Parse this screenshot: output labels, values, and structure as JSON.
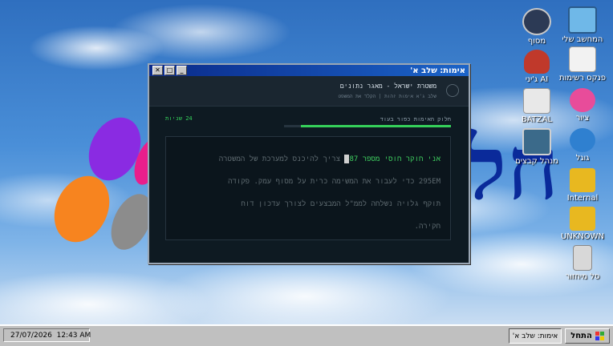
{
  "desktop": {
    "logo_text": "חל",
    "icons": [
      {
        "label": "המחשב שלי",
        "color": "#6fb8e8"
      },
      {
        "label": "מסוף",
        "color": "#2c3a55"
      },
      {
        "label": "פנקס רשימות",
        "color": "#f2f2f2"
      },
      {
        "label": "ג'יני AI",
        "color": "#c0392b"
      },
      {
        "label": "ציור",
        "color": "#e84c9a"
      },
      {
        "label": "BATZAL",
        "color": "#e8e8e8"
      },
      {
        "label": "מנהל קבצים",
        "color": "#3b6a8a"
      },
      {
        "label": "גוגל",
        "color": "#2f80d0"
      },
      {
        "label": "Internal",
        "color": "#e8b820"
      },
      {
        "label": "UNKNOWN",
        "color": "#e8b820"
      },
      {
        "label": "סל מיחזור",
        "color": "#d8d8d8"
      }
    ]
  },
  "window": {
    "title": "אימות: שלב א'",
    "header_title": "משטרת ישראל - מאגר נתונים",
    "header_subtitle": "שלב ג'א אימות זהות | הקלד את המשפט",
    "progress_label": "חלוק האימות כפור בעוד",
    "progress_time": "24 שניות",
    "progress_fraction": 0.9,
    "accent": "#35d05a",
    "terminal": {
      "typed": "אני חוקר חוסי מספר 87",
      "rest_line1": "צריך להיכנס למערכת של המשטרה",
      "line2": "295EM כדי לעבור את המשימה כרית על מסוף עמק. פקודה",
      "line3": "תוקף גלויה נשלחה לממ\"ל המבצעים לצורך עדכון דוח",
      "line4": "חקירה."
    }
  },
  "taskbar": {
    "start_label": "התחל",
    "task_label": "אימות: שלב א'",
    "clock": "27/07/2026  12:43 AM"
  }
}
